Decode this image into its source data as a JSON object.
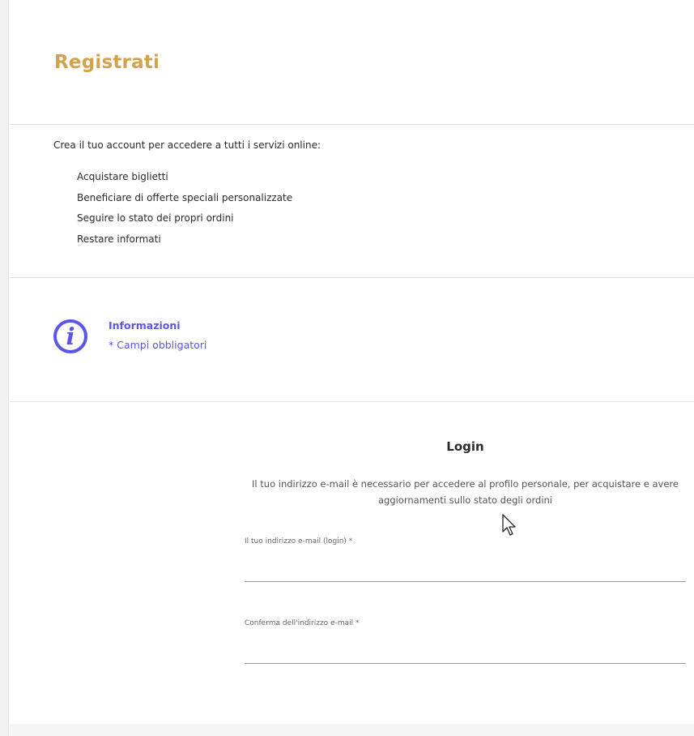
{
  "page": {
    "title": "Registrati"
  },
  "intro": {
    "text": "Crea il tuo account per accedere a tutti i servizi online:",
    "benefits": [
      "Acquistare biglietti",
      "Beneficiare di offerte speciali personalizzate",
      "Seguire lo stato dei propri ordini",
      "Restare informati"
    ]
  },
  "info": {
    "icon": "info-icon",
    "icon_glyph": "i",
    "title": "Informazioni",
    "note": "* Campi obbligatori"
  },
  "login": {
    "title": "Login",
    "description": "Il tuo indirizzo e-mail è necessario per accedere al profilo personale, per acquistare e avere aggiornamenti sullo stato degli ordini",
    "email_label": "Il tuo indirizzo e-mail (login)  *",
    "email_value": "",
    "confirm_label": "Conferma dell'indirizzo e-mail  *",
    "confirm_value": ""
  },
  "colors": {
    "title": "#d4a24a",
    "accent": "#5b55e8"
  }
}
